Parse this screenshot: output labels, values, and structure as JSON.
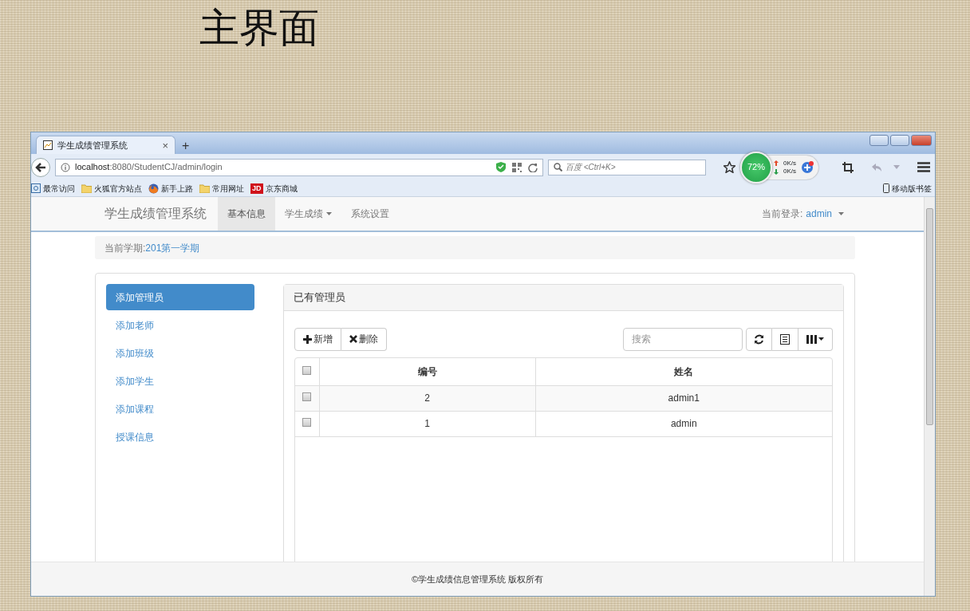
{
  "slide_title": "主界面",
  "browser": {
    "tab": {
      "title": "学生成绩管理系统",
      "close": "×"
    },
    "new_tab": "+",
    "url": {
      "host": "localhost",
      "rest": ":8080/StudentCJ/admin/login"
    },
    "search_placeholder": "百度 <Ctrl+K>",
    "monitor": {
      "percent": "72%",
      "up": "0K/s",
      "down": "0K/s"
    },
    "bookmarks": [
      {
        "label": "最常访问",
        "kind": "page"
      },
      {
        "label": "火狐官方站点",
        "kind": "folder"
      },
      {
        "label": "新手上路",
        "kind": "firefox"
      },
      {
        "label": "常用网址",
        "kind": "folder"
      },
      {
        "label": "京东商城",
        "kind": "jd",
        "badge": "JD"
      }
    ],
    "mobile_bookmarks": "移动版书签"
  },
  "app": {
    "brand": "学生成绩管理系统",
    "nav": [
      {
        "label": "基本信息",
        "selected": true,
        "dropdown": false
      },
      {
        "label": "学生成绩",
        "selected": false,
        "dropdown": true
      },
      {
        "label": "系统设置",
        "selected": false,
        "dropdown": false
      }
    ],
    "user": {
      "label": "当前登录:",
      "name": "admin"
    },
    "term": {
      "label": "当前学期:",
      "value": "201第一学期"
    },
    "sidebar": [
      {
        "label": "添加管理员",
        "selected": true
      },
      {
        "label": "添加老师",
        "selected": false
      },
      {
        "label": "添加班级",
        "selected": false
      },
      {
        "label": "添加学生",
        "selected": false
      },
      {
        "label": "添加课程",
        "selected": false
      },
      {
        "label": "授课信息",
        "selected": false
      }
    ],
    "panel_title": "已有管理员",
    "buttons": [
      {
        "kind": "add",
        "label": "新增"
      },
      {
        "kind": "delete",
        "label": "删除"
      }
    ],
    "search_placeholder": "搜索",
    "table": {
      "select_all_checked": false,
      "columns": [
        "编号",
        "姓名"
      ],
      "rows": [
        {
          "cells": [
            "2",
            "admin1"
          ],
          "checked": false
        },
        {
          "cells": [
            "1",
            "admin"
          ],
          "checked": false
        }
      ]
    },
    "footer": "©学生成绩信息管理系统 版权所有"
  }
}
